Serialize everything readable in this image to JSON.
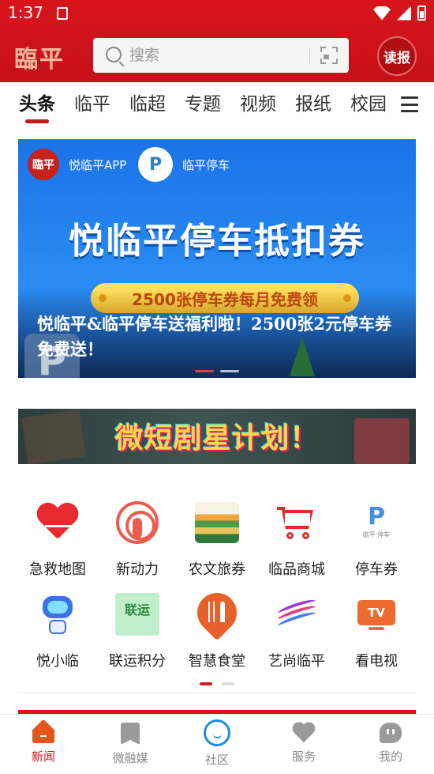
{
  "status_bar": {
    "time": "1:37"
  },
  "header": {
    "logo": "臨平",
    "search_placeholder": "搜索",
    "read_badge": "读报"
  },
  "tabs": [
    {
      "label": "头条",
      "active": true
    },
    {
      "label": "临平"
    },
    {
      "label": "临超"
    },
    {
      "label": "专题"
    },
    {
      "label": "视频"
    },
    {
      "label": "报纸"
    },
    {
      "label": "校园"
    }
  ],
  "banner": {
    "app1_logo": "臨平",
    "app1_name": "悦临平APP",
    "app2_name": "临平停车",
    "headline": "悦临平停车抵扣券",
    "pill": "2500张停车券每月免费领",
    "caption": "悦临平&临平停车送福利啦！2500张2元停车券免费送！"
  },
  "promo": {
    "text": "微短剧星计划！"
  },
  "services": [
    [
      {
        "label": "急救地图",
        "icon": "heart-pulse-icon"
      },
      {
        "label": "新动力",
        "icon": "microphone-icon"
      },
      {
        "label": "农文旅券",
        "icon": "landscape-icon"
      },
      {
        "label": "临品商城",
        "icon": "cart-icon"
      },
      {
        "label": "停车券",
        "icon": "parking-logo-icon"
      }
    ],
    [
      {
        "label": "悦小临",
        "icon": "robot-icon"
      },
      {
        "label": "联运积分",
        "icon": "lianyun-icon",
        "icon_text": "联运"
      },
      {
        "label": "智慧食堂",
        "icon": "fork-knife-icon"
      },
      {
        "label": "艺尚临平",
        "icon": "swoosh-icon"
      },
      {
        "label": "看电视",
        "icon": "tv-icon",
        "icon_text": "TV"
      }
    ]
  ],
  "bottom_nav": [
    {
      "label": "新闻",
      "icon": "home-icon",
      "active": true
    },
    {
      "label": "微融媒",
      "icon": "bookmark-icon"
    },
    {
      "label": "社区",
      "icon": "smile-circle-icon"
    },
    {
      "label": "服务",
      "icon": "heart-icon"
    },
    {
      "label": "我的",
      "icon": "profile-icon"
    }
  ],
  "colors": {
    "brand_red": "#d9141b",
    "banner_blue": "#1a73e8",
    "community_blue": "#1c8ce0"
  }
}
